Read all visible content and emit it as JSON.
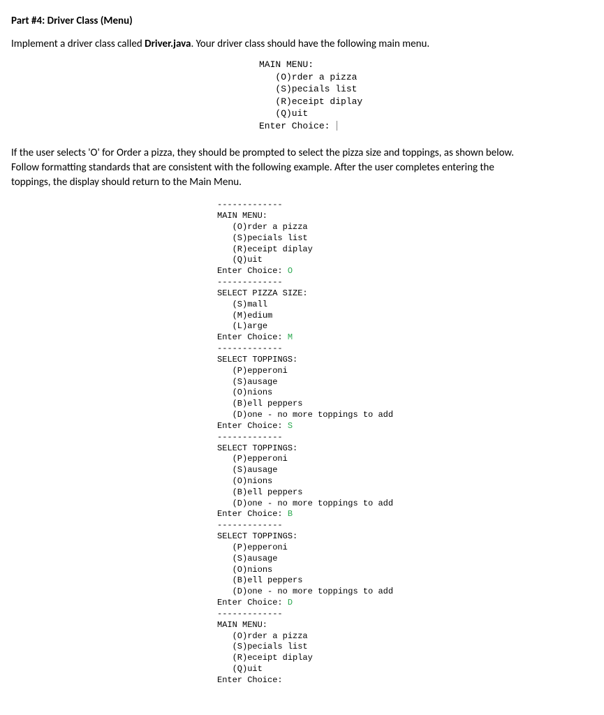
{
  "heading": "Part #4:  Driver Class (Menu)",
  "intro": {
    "pre": "Implement a driver class called ",
    "bold": "Driver.java",
    "post": ".  Your driver class should have the following main menu."
  },
  "menu1": {
    "title": "MAIN MENU:",
    "opt1": "(O)rder a pizza",
    "opt2": "(S)pecials list",
    "opt3": "(R)eceipt diplay",
    "opt4": "(Q)uit",
    "prompt": "Enter Choice: "
  },
  "para2_line1": "If the user selects 'O' for Order a pizza, they should be prompted to select the pizza size and toppings, as shown below.",
  "para2_line2": "Follow formatting standards that are consistent with the following example.  After the user completes entering the",
  "para2_line3": "toppings, the display should return to the Main Menu.",
  "sep": "-------------",
  "block": {
    "main": {
      "title": "MAIN MENU:",
      "o1": "(O)rder a pizza",
      "o2": "(S)pecials list",
      "o3": "(R)eceipt diplay",
      "o4": "(Q)uit",
      "prompt": "Enter Choice: ",
      "input": "O"
    },
    "size": {
      "title": "SELECT PIZZA SIZE:",
      "o1": "(S)mall",
      "o2": "(M)edium",
      "o3": "(L)arge",
      "prompt": "Enter Choice: ",
      "input": "M"
    },
    "top1": {
      "title": "SELECT TOPPINGS:",
      "o1": "(P)epperoni",
      "o2": "(S)ausage",
      "o3": "(O)nions",
      "o4": "(B)ell peppers",
      "o5": "(D)one - no more toppings to add",
      "prompt": "Enter Choice: ",
      "input": "S"
    },
    "top2": {
      "title": "SELECT TOPPINGS:",
      "o1": "(P)epperoni",
      "o2": "(S)ausage",
      "o3": "(O)nions",
      "o4": "(B)ell peppers",
      "o5": "(D)one - no more toppings to add",
      "prompt": "Enter Choice: ",
      "input": "B"
    },
    "top3": {
      "title": "SELECT TOPPINGS:",
      "o1": "(P)epperoni",
      "o2": "(S)ausage",
      "o3": "(O)nions",
      "o4": "(B)ell peppers",
      "o5": "(D)one - no more toppings to add",
      "prompt": "Enter Choice: ",
      "input": "D"
    },
    "main2": {
      "title": "MAIN MENU:",
      "o1": "(O)rder a pizza",
      "o2": "(S)pecials list",
      "o3": "(R)eceipt diplay",
      "o4": "(Q)uit",
      "prompt": "Enter Choice:"
    }
  }
}
